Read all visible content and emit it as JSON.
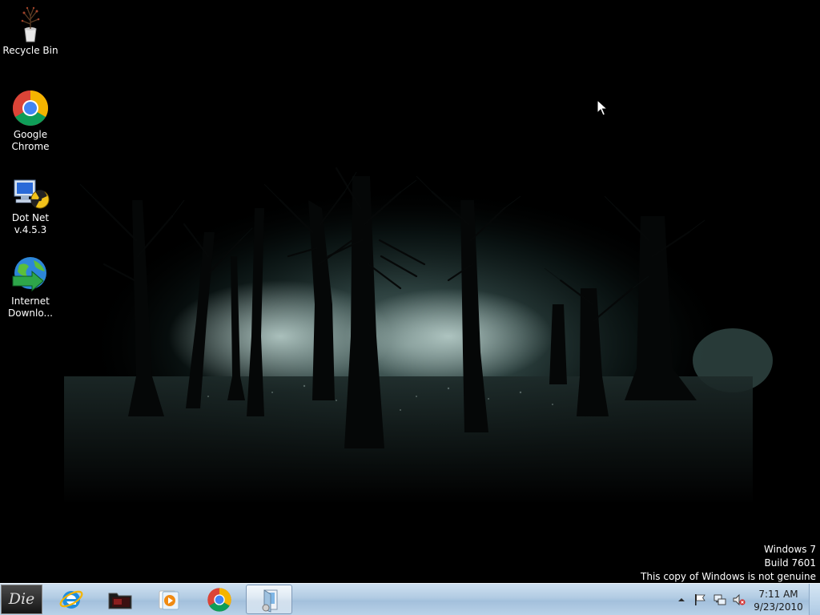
{
  "desktop": {
    "icons": [
      {
        "label_1": "Recycle Bin",
        "label_2": "",
        "icon": "recycle-bin-icon"
      },
      {
        "label_1": "Google",
        "label_2": "Chrome",
        "icon": "chrome-icon"
      },
      {
        "label_1": "Dot Net",
        "label_2": "v.4.5.3",
        "icon": "dotnet-installer-icon"
      },
      {
        "label_1": "Internet",
        "label_2": "Downlo...",
        "icon": "internet-download-manager-icon"
      }
    ]
  },
  "watermark": {
    "line1": "Windows 7",
    "line2": "Build 7601",
    "line3": "This copy of Windows is not genuine"
  },
  "taskbar": {
    "start_label": "Die",
    "pinned": [
      {
        "icon": "internet-explorer-icon"
      },
      {
        "icon": "media-folder-icon"
      },
      {
        "icon": "media-player-icon"
      },
      {
        "icon": "chrome-icon"
      },
      {
        "icon": "setup-program-icon",
        "active": true
      }
    ],
    "tray": {
      "icons": [
        "show-hidden-icons-arrow",
        "action-center-flag-icon",
        "network-icon",
        "volume-muted-icon"
      ]
    },
    "clock": {
      "time": "7:11 AM",
      "date": "9/23/2010"
    }
  },
  "colors": {
    "taskbar": "#b1cbe3",
    "desktop_text": "#ffffff",
    "fog": "#3e5a58"
  }
}
